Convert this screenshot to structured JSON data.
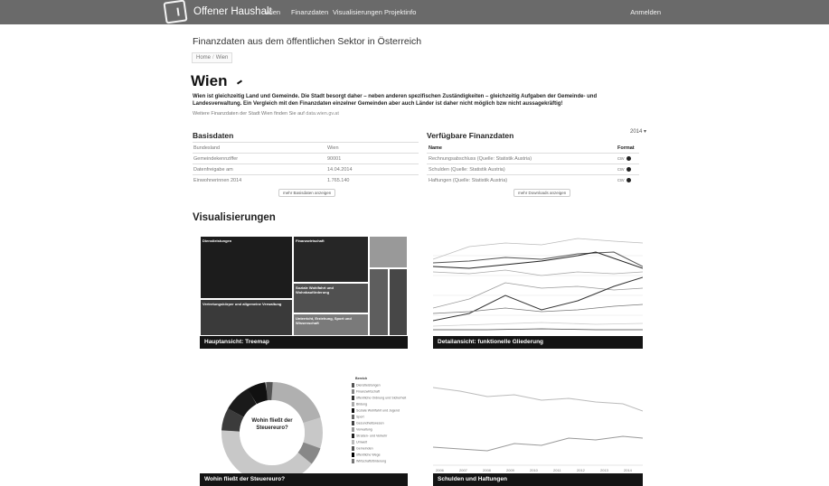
{
  "nav": {
    "brand": "Offener Haushalt",
    "items": [
      "Wien",
      "Finanzdaten",
      "Visualisierungen",
      "Projektinfo"
    ],
    "login": "Anmelden"
  },
  "page": {
    "subtitle": "Finanzdaten aus dem öffentlichen Sektor in Österreich",
    "breadcrumb": [
      "Home",
      "Wien"
    ],
    "city": "Wien",
    "intro": "Wien ist gleichzeitig Land und Gemeinde. Die Stadt besorgt daher – neben anderen spezifischen Zuständigkeiten – gleichzeitig Aufgaben der Gemeinde- und Landesverwaltung. Ein Vergleich mit den Finanzdaten einzelner Gemeinden aber auch Länder ist daher nicht möglich bzw nicht aussagekräftig!",
    "intro_note": "Weitere Finanzdaten der Stadt Wien finden Sie auf",
    "intro_link": "data.wien.gv.at"
  },
  "basisdaten": {
    "title": "Basisdaten",
    "rows": [
      {
        "label": "Bundesland",
        "value": "Wien"
      },
      {
        "label": "Gemeindekennziffer",
        "value": "90001"
      },
      {
        "label": "Datenfreigabe am",
        "value": "14.04.2014"
      },
      {
        "label": "Einwohnerinnen 2014",
        "value": "1.765.140"
      }
    ],
    "button": "mehr Basisdaten anzeigen"
  },
  "finanzdaten": {
    "title": "Verfügbare Finanzdaten",
    "year": "2014 ▾",
    "col_name": "Name",
    "col_format": "Format",
    "rows": [
      {
        "name": "Rechnungsabschluss (Quelle: Statistik Austria)",
        "format": "csv"
      },
      {
        "name": "Schulden (Quelle: Statistik Austria)",
        "format": "csv"
      },
      {
        "name": "Haftungen (Quelle: Statistik Austria)",
        "format": "csv"
      }
    ],
    "button": "mehr Downloads anzeigen"
  },
  "viz": {
    "title": "Visualisierungen",
    "cards": [
      {
        "caption": "Hauptansicht: Treemap"
      },
      {
        "caption": "Detailansicht: funktionelle Gliederung"
      },
      {
        "caption": "Wohin fließt der Steuereuro?"
      },
      {
        "caption": "Schulden und Haftungen"
      }
    ],
    "treemap_labels": [
      "Dienstleistungen",
      "Finanzwirtschaft",
      "Soziale Wohlfahrt und Wohnbauförderung",
      "Vertretungskörper und allgemeine Verwaltung",
      "Unterricht, Erziehung, Sport und Wissenschaft"
    ],
    "donut_center": "Wohin fließt der Steuereuro?",
    "legend_title": "Bereich",
    "legend_items": [
      "Dienstleistungen",
      "Finanzwirtschaft",
      "öffentliche Ordnung und Sicherheit",
      "Bildung",
      "Soziale Wohlfahrt und Jugend",
      "Sport",
      "Gesundheitswesen",
      "Verwaltung",
      "Straßen- und Verkehr",
      "Umwelt",
      "Gemeinden",
      "öffentliche Wege",
      "Wirtschaftsförderung"
    ],
    "years": [
      "2006",
      "2007",
      "2008",
      "2009",
      "2010",
      "2011",
      "2012",
      "2013",
      "2014"
    ]
  }
}
